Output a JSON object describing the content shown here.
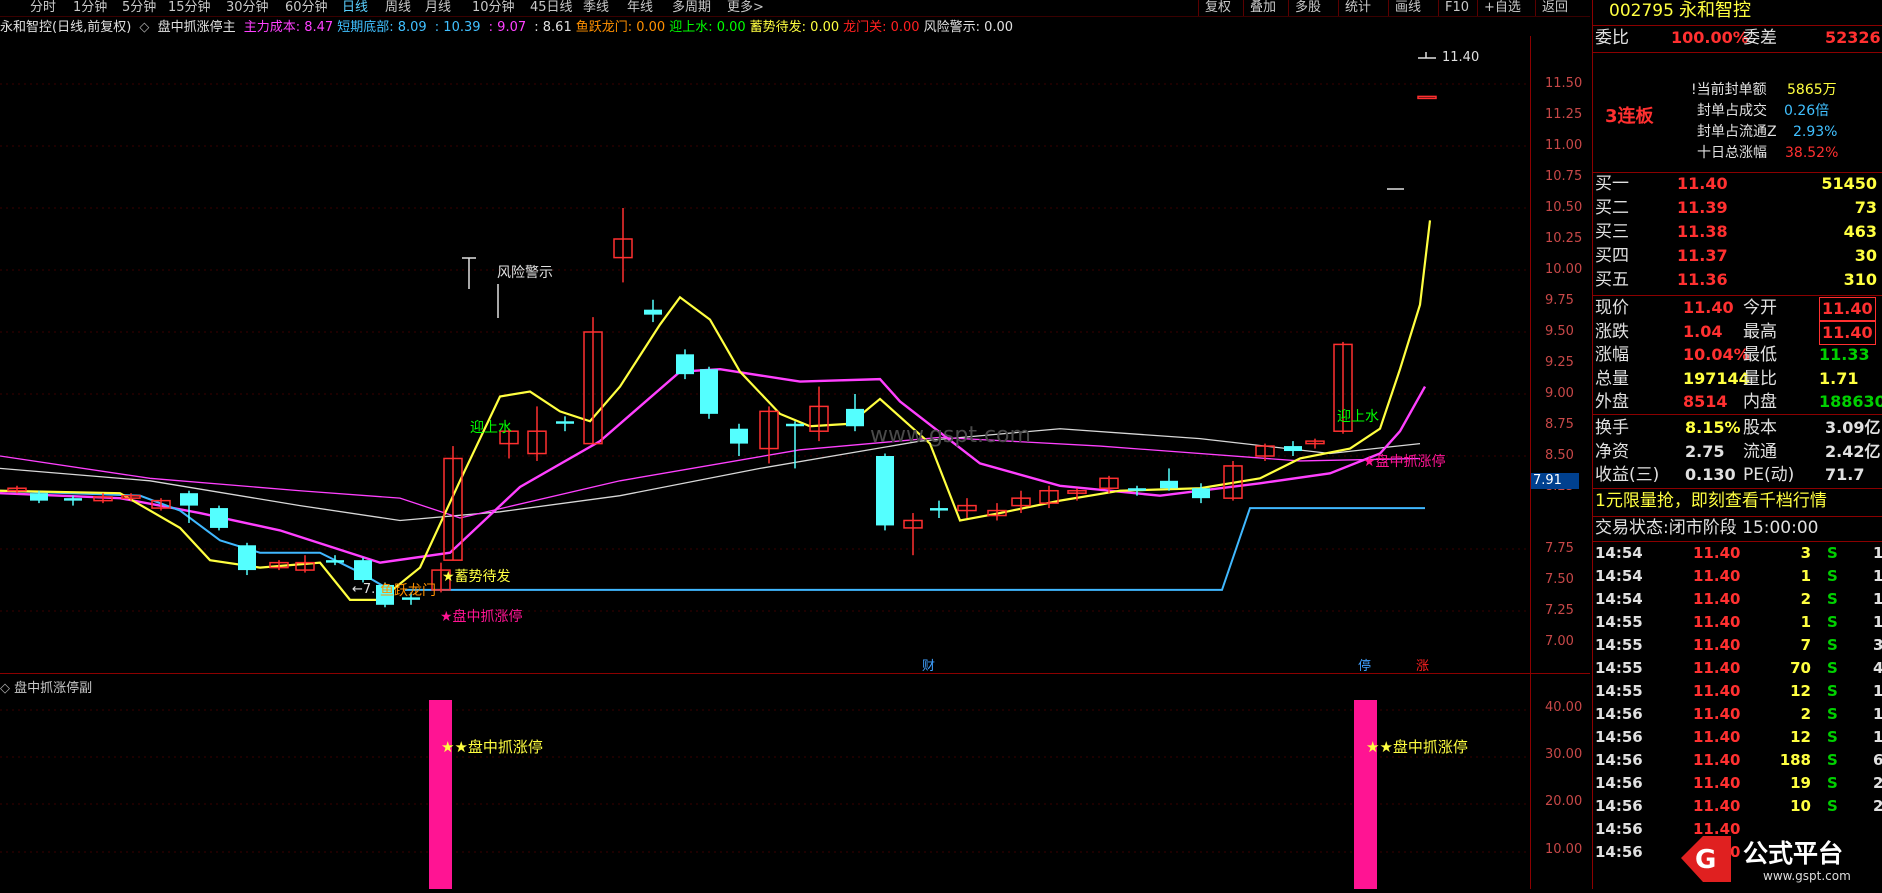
{
  "toolbar": {
    "timeframes": [
      "分时",
      "1分钟",
      "5分钟",
      "15分钟",
      "30分钟",
      "60分钟",
      "日线",
      "周线",
      "月线",
      "10分钟",
      "45日线",
      "季线",
      "年线",
      "多周期",
      "更多>"
    ],
    "active": "日线",
    "right_buttons": [
      "复权",
      "叠加",
      "多股",
      "统计",
      "画线",
      "F10",
      "+自选",
      "返回"
    ]
  },
  "indicator_line": {
    "stock": "永和智控(日线,前复权)",
    "formula": "盘中抓涨停主",
    "items": [
      {
        "label": "主力成本:",
        "value": "8.47",
        "color": "#ff40ff"
      },
      {
        "label": "短期底部:",
        "value": "8.09",
        "color": "#40c0ff"
      },
      {
        "label": "",
        "value": ": 10.39",
        "color": "#40c0ff"
      },
      {
        "label": "",
        "value": ": 9.07",
        "color": "#ff40ff"
      },
      {
        "label": "",
        "value": ": 8.61",
        "color": "#e0e0e0"
      },
      {
        "label": "鱼跃龙门:",
        "value": "0.00",
        "color": "#ff9000"
      },
      {
        "label": "迎上水:",
        "value": "0.00",
        "color": "#00ff00"
      },
      {
        "label": "蓄势待发:",
        "value": "0.00",
        "color": "#ffff40"
      },
      {
        "label": "龙门关:",
        "value": "0.00",
        "color": "#ff2020"
      },
      {
        "label": "风险警示:",
        "value": "0.00",
        "color": "#e0e0e0"
      }
    ]
  },
  "price_axis": [
    "11.50",
    "11.25",
    "11.00",
    "10.75",
    "10.50",
    "10.25",
    "10.00",
    "9.75",
    "9.50",
    "9.25",
    "9.00",
    "8.75",
    "8.50",
    "8.25",
    "7.75",
    "7.50",
    "7.25",
    "7.00"
  ],
  "current_price_tag": "7.91",
  "annotations": {
    "top_label": "11.40",
    "risk": "风险警示",
    "ying1": "迎上水",
    "ying2": "迎上水",
    "xushi": "★蓄势待发",
    "yuyue": "鱼跃龙门",
    "low_mark": "←7.",
    "zt_main1": "★盘中抓涨停",
    "zt_main2": "★盘中抓涨停",
    "watermark": "www.gspt.com",
    "cai": "财",
    "ting": "停",
    "zhang": "涨"
  },
  "sub_chart": {
    "title": "盘中抓涨停副",
    "axis": [
      "40.00",
      "30.00",
      "20.00",
      "10.00"
    ],
    "label1": "★★盘中抓涨停",
    "label2": "★★盘中抓涨停"
  },
  "panel": {
    "code": "002795",
    "name": "永和智控",
    "weibi_label": "委比",
    "weibi_value": "100.00%",
    "weicha_label": "委差",
    "weicha_value": "52326",
    "lianban": "3连板",
    "seal_amount_label": "!当前封单额",
    "seal_amount": "5865万",
    "seal_ratio_label": "封单占成交",
    "seal_ratio": "0.26倍",
    "seal_float_label": "封单占流通Z",
    "seal_float": "2.93%",
    "ten_day_label": "十日总涨幅",
    "ten_day": "38.52%",
    "buys": [
      {
        "label": "买一",
        "price": "11.40",
        "vol": "51450"
      },
      {
        "label": "买二",
        "price": "11.39",
        "vol": "73"
      },
      {
        "label": "买三",
        "price": "11.38",
        "vol": "463"
      },
      {
        "label": "买四",
        "price": "11.37",
        "vol": "30"
      },
      {
        "label": "买五",
        "price": "11.36",
        "vol": "310"
      }
    ],
    "stats": [
      {
        "l1": "现价",
        "v1": "11.40",
        "l2": "今开",
        "v2": "11.40"
      },
      {
        "l1": "涨跌",
        "v1": "1.04",
        "l2": "最高",
        "v2": "11.40"
      },
      {
        "l1": "涨幅",
        "v1": "10.04%",
        "l2": "最低",
        "v2": "11.33"
      },
      {
        "l1": "总量",
        "v1": "197144",
        "l2": "量比",
        "v2": "1.71"
      },
      {
        "l1": "外盘",
        "v1": "8514",
        "l2": "内盘",
        "v2": "188630"
      }
    ],
    "stats2": [
      {
        "l1": "换手",
        "v1": "8.15%",
        "l2": "股本",
        "v2": "3.09亿"
      },
      {
        "l1": "净资",
        "v1": "2.75",
        "l2": "流通",
        "v2": "2.42亿"
      },
      {
        "l1": "收益(三)",
        "v1": "0.130",
        "l2": "PE(动)",
        "v2": "71.7"
      }
    ],
    "promo": "1元限量抢，即刻查看千档行情",
    "trade_state": "交易状态:闭市阶段 15:00:00",
    "trades": [
      {
        "t": "14:54",
        "p": "11.40",
        "v": "3",
        "s": "S",
        "n": "1"
      },
      {
        "t": "14:54",
        "p": "11.40",
        "v": "1",
        "s": "S",
        "n": "1"
      },
      {
        "t": "14:54",
        "p": "11.40",
        "v": "2",
        "s": "S",
        "n": "1"
      },
      {
        "t": "14:55",
        "p": "11.40",
        "v": "1",
        "s": "S",
        "n": "1"
      },
      {
        "t": "14:55",
        "p": "11.40",
        "v": "7",
        "s": "S",
        "n": "3"
      },
      {
        "t": "14:55",
        "p": "11.40",
        "v": "70",
        "s": "S",
        "n": "4"
      },
      {
        "t": "14:55",
        "p": "11.40",
        "v": "12",
        "s": "S",
        "n": "1"
      },
      {
        "t": "14:56",
        "p": "11.40",
        "v": "2",
        "s": "S",
        "n": "1"
      },
      {
        "t": "14:56",
        "p": "11.40",
        "v": "12",
        "s": "S",
        "n": "1"
      },
      {
        "t": "14:56",
        "p": "11.40",
        "v": "188",
        "s": "S",
        "n": "6"
      },
      {
        "t": "14:56",
        "p": "11.40",
        "v": "19",
        "s": "S",
        "n": "2"
      },
      {
        "t": "14:56",
        "p": "11.40",
        "v": "10",
        "s": "S",
        "n": "2"
      },
      {
        "t": "14:56",
        "p": "11.40",
        "v": "",
        "s": "",
        "n": ""
      },
      {
        "t": "14:56",
        "p": "11.40",
        "v": "",
        "s": "",
        "n": ""
      }
    ]
  },
  "logo": {
    "text": "公式平台",
    "url": "www.gspt.com"
  },
  "colors": {
    "up": "#ff3030",
    "down": "#54ffff",
    "yellow": "#ffff40",
    "magenta": "#ff40ff",
    "white": "#d8d8d8",
    "blue": "#40b8ff",
    "pink": "#ff1493"
  }
}
